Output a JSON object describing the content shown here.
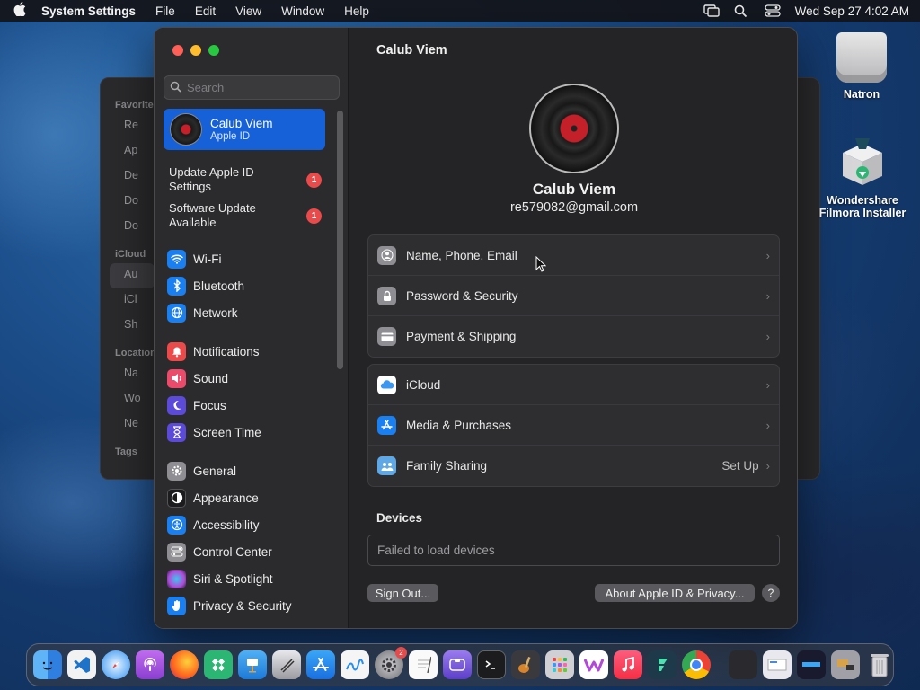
{
  "menubar": {
    "app_name": "System Settings",
    "menus": [
      "File",
      "Edit",
      "View",
      "Window",
      "Help"
    ],
    "clock": "Wed Sep 27  4:02 AM"
  },
  "background_window": {
    "sections": [
      {
        "title": "Favorites",
        "items": [
          "Re",
          "Ap",
          "De",
          "Do",
          "Do"
        ]
      },
      {
        "title": "iCloud",
        "items": [
          "Au",
          "iCl",
          "Sh"
        ]
      },
      {
        "title": "Locations",
        "items": [
          "Na",
          "Wo",
          "Ne"
        ]
      },
      {
        "title": "Tags",
        "items": []
      }
    ]
  },
  "sidebar": {
    "search_placeholder": "Search",
    "profile": {
      "name": "Calub Viem",
      "subtitle": "Apple ID"
    },
    "notifications": [
      {
        "label": "Update Apple ID Settings",
        "badge": "1"
      },
      {
        "label": "Software Update Available",
        "badge": "1"
      }
    ],
    "groups": [
      [
        {
          "label": "Wi-Fi",
          "icon": "wifi-icon",
          "color": "#1a7ff0"
        },
        {
          "label": "Bluetooth",
          "icon": "bluetooth-icon",
          "color": "#1a7ff0"
        },
        {
          "label": "Network",
          "icon": "globe-icon",
          "color": "#1a7ff0"
        }
      ],
      [
        {
          "label": "Notifications",
          "icon": "bell-icon",
          "color": "#eb4a4a"
        },
        {
          "label": "Sound",
          "icon": "speaker-icon",
          "color": "#eb4a6a"
        },
        {
          "label": "Focus",
          "icon": "moon-icon",
          "color": "#5b4bd8"
        },
        {
          "label": "Screen Time",
          "icon": "hourglass-icon",
          "color": "#5b4bd8"
        }
      ],
      [
        {
          "label": "General",
          "icon": "gear-icon",
          "color": "#8e8e93"
        },
        {
          "label": "Appearance",
          "icon": "appearance-icon",
          "color": "#1c1c1e"
        },
        {
          "label": "Accessibility",
          "icon": "accessibility-icon",
          "color": "#1a7ff0"
        },
        {
          "label": "Control Center",
          "icon": "control-center-icon",
          "color": "#8e8e93"
        },
        {
          "label": "Siri & Spotlight",
          "icon": "siri-icon",
          "color": "#b04bd8"
        },
        {
          "label": "Privacy & Security",
          "icon": "hand-icon",
          "color": "#1a7ff0"
        }
      ]
    ]
  },
  "content": {
    "title": "Calub Viem",
    "user_name": "Calub Viem",
    "user_email": "re579082@gmail.com",
    "group1": [
      {
        "label": "Name, Phone, Email",
        "icon": "person-icon",
        "color": "#8e8e93"
      },
      {
        "label": "Password & Security",
        "icon": "lock-icon",
        "color": "#8e8e93"
      },
      {
        "label": "Payment & Shipping",
        "icon": "card-icon",
        "color": "#8e8e93"
      }
    ],
    "group2": [
      {
        "label": "iCloud",
        "icon": "cloud-icon",
        "color": "#ffffff",
        "trail": ""
      },
      {
        "label": "Media & Purchases",
        "icon": "app-store-icon",
        "color": "#1a7ff0",
        "trail": ""
      },
      {
        "label": "Family Sharing",
        "icon": "family-icon",
        "color": "#5fa8e8",
        "trail": "Set Up"
      }
    ],
    "devices_header": "Devices",
    "devices_status": "Failed to load devices",
    "sign_out": "Sign Out...",
    "about": "About Apple ID & Privacy...",
    "help": "?"
  },
  "desktop": {
    "icons": [
      {
        "label": "Natron"
      },
      {
        "label": "Wondershare Filmora Installer"
      }
    ]
  },
  "dock": {
    "apps": [
      {
        "name": "finder-icon",
        "color": "#2f8cf0"
      },
      {
        "name": "vscode-icon",
        "color": "#1e73c9"
      },
      {
        "name": "safari-icon",
        "color": "#2d8ff2"
      },
      {
        "name": "podcasts-icon",
        "color": "#9b4ad8"
      },
      {
        "name": "firefox-icon",
        "color": "#ff6a1f"
      },
      {
        "name": "app-green-icon",
        "color": "#2bb673"
      },
      {
        "name": "keynote-icon",
        "color": "#2a94e6"
      },
      {
        "name": "script-editor-icon",
        "color": "#b8b8be"
      },
      {
        "name": "app-store-icon",
        "color": "#1a7ff0"
      },
      {
        "name": "freeform-icon",
        "color": "#f2f2f2"
      },
      {
        "name": "system-settings-icon",
        "color": "#8e8e93",
        "badge": "2"
      },
      {
        "name": "textedit-icon",
        "color": "#f5f5f5"
      },
      {
        "name": "notchmeister-icon",
        "color": "#7b5bd8"
      },
      {
        "name": "terminal-icon",
        "color": "#1c1c1e"
      },
      {
        "name": "instruments-icon",
        "color": "#3a3a3e"
      },
      {
        "name": "launchpad-icon",
        "color": "#c8c8cc"
      },
      {
        "name": "wondershare-icon",
        "color": "#ffffff"
      },
      {
        "name": "music-icon",
        "color": "#fa3c55"
      },
      {
        "name": "filmora-icon",
        "color": "#1e3a4a"
      },
      {
        "name": "chrome-icon",
        "color": "#f2f2f2"
      }
    ],
    "stacks": [
      {
        "name": "stack-1-icon",
        "color": "#2a2a2e"
      },
      {
        "name": "stack-2-icon",
        "color": "#e8e8ee"
      },
      {
        "name": "stack-3-icon",
        "color": "#1a1a2e"
      },
      {
        "name": "stack-4-icon",
        "color": "#a0a0a6"
      },
      {
        "name": "trash-icon",
        "color": "#c0c0c4"
      }
    ]
  }
}
